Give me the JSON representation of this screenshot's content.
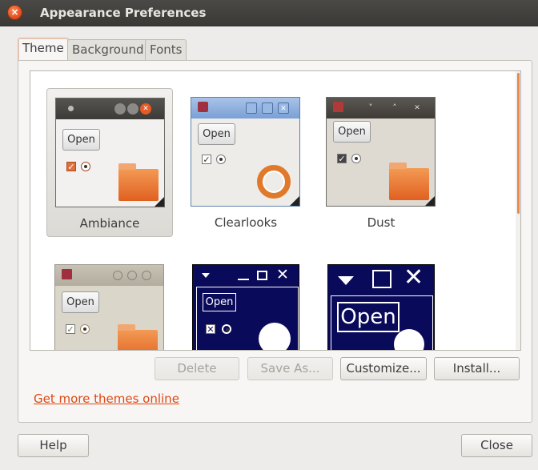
{
  "window": {
    "title": "Appearance Preferences",
    "close_glyph": "×"
  },
  "tabs": [
    {
      "label": "Theme",
      "active": true
    },
    {
      "label": "Background",
      "active": false
    },
    {
      "label": "Fonts",
      "active": false
    }
  ],
  "themes": [
    {
      "name": "Ambiance",
      "selected": true,
      "preview_button": "Open"
    },
    {
      "name": "Clearlooks",
      "selected": false,
      "preview_button": "Open"
    },
    {
      "name": "Dust",
      "selected": false,
      "preview_button": "Open"
    },
    {
      "name": "",
      "selected": false,
      "preview_button": "Open"
    },
    {
      "name": "",
      "selected": false,
      "preview_button": "Open"
    },
    {
      "name": "",
      "selected": false,
      "preview_button": "Open"
    }
  ],
  "actions": {
    "delete": "Delete",
    "save_as": "Save As...",
    "customize": "Customize...",
    "install": "Install..."
  },
  "link": {
    "label": "Get more themes online"
  },
  "footer": {
    "help": "Help",
    "close": "Close"
  },
  "colors": {
    "accent": "#dd4814",
    "titlebar": "#3c3b37",
    "window_bg": "#edecea"
  },
  "icons": {
    "close": "close-icon",
    "folder": "folder-icon",
    "ubuntu_logo": "ubuntu-logo-icon",
    "gnome_foot": "gnome-foot-icon"
  }
}
